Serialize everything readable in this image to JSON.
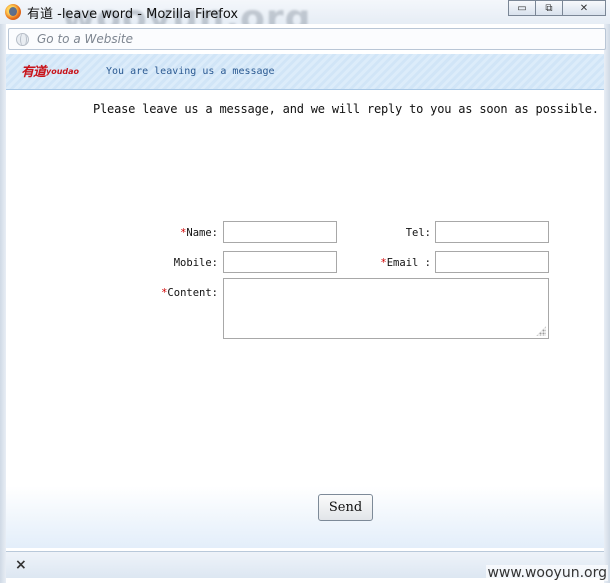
{
  "window": {
    "title": "有道 -leave word - Mozilla Firefox",
    "minimize_icon": "minimize-icon",
    "maximize_icon": "maximize-icon",
    "close_icon": "close-icon",
    "minimize_glyph": "▭",
    "maximize_glyph": "⧉",
    "close_glyph": "✕"
  },
  "address_bar": {
    "placeholder": "Go to a Website",
    "icon": "globe-icon"
  },
  "header": {
    "logo_cn": "有道",
    "logo_en": "youdao",
    "message": "You are leaving us a message",
    "background_color": "#d6e8f8"
  },
  "intro": "Please leave us a message, and we will reply to you as soon as possible.",
  "form": {
    "required_mark": "*",
    "name_label": "Name:",
    "tel_label": "Tel:",
    "mobile_label": "Mobile:",
    "email_label": "Email :",
    "content_label": "Content:",
    "name_value": "",
    "tel_value": "",
    "mobile_value": "",
    "email_value": "",
    "content_value": ""
  },
  "send_button": "Send",
  "statusbar": {
    "close_glyph": "×"
  },
  "watermarks": {
    "top": "wooyun.org",
    "bottom": "www.wooyun.org"
  },
  "colors": {
    "required": "#d00000",
    "brand": "#c8141b",
    "header_text": "#2b5a92"
  }
}
